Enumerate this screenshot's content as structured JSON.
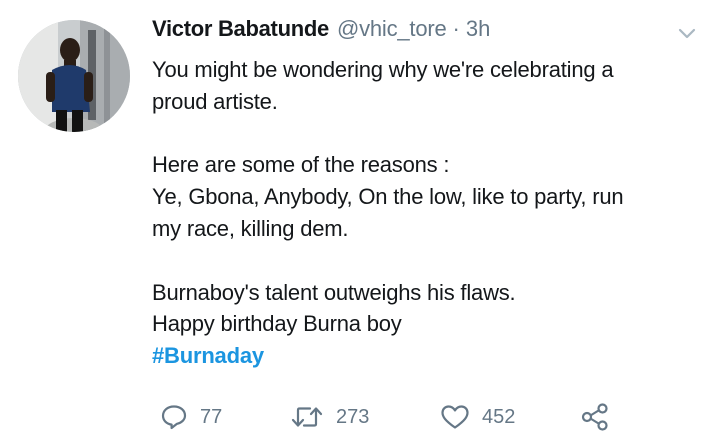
{
  "tweet": {
    "author_name": "Victor Babatunde",
    "handle": "@vhic_tore",
    "separator": "·",
    "time": "3h",
    "avatar_icon": "user-avatar-photo",
    "lines": {
      "l1": "You might be wondering why we're celebrating a",
      "l2": "proud artiste.",
      "l3": "Here are some of the reasons :",
      "l4": "Ye, Gbona, Anybody, On the low, like to party, run",
      "l5": "my race, killing dem.",
      "l6": "Burnaboy's talent outweighs his flaws.",
      "l7": "Happy birthday Burna boy"
    },
    "hashtag": "#Burnaday",
    "hashtag_color": "#1b95e0",
    "actions": {
      "reply_icon": "reply-icon",
      "reply_count": "77",
      "retweet_icon": "retweet-icon",
      "retweet_count": "273",
      "like_icon": "heart-icon",
      "like_count": "452",
      "share_icon": "share-icon"
    }
  },
  "colors": {
    "text": "#14171a",
    "muted": "#657786",
    "link": "#1b95e0"
  }
}
